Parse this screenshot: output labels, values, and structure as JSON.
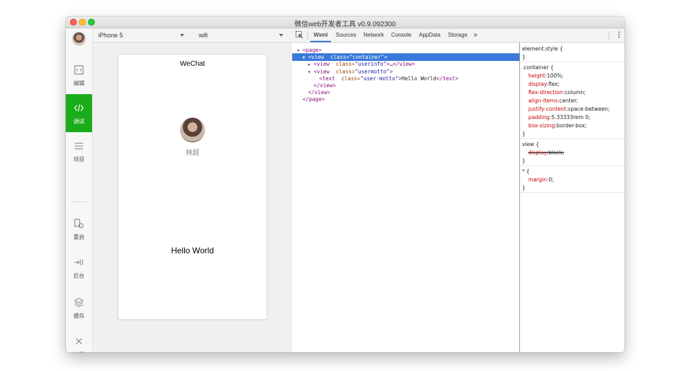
{
  "window": {
    "title": "微信web开发者工具 v0.9.092300"
  },
  "sidebar": {
    "items": [
      {
        "label": "编辑",
        "icon": "code-box-icon"
      },
      {
        "label": "调试",
        "icon": "code-icon",
        "active": true
      },
      {
        "label": "项目",
        "icon": "menu-icon"
      },
      {
        "label": "重启",
        "icon": "restart-icon"
      },
      {
        "label": "后台",
        "icon": "background-icon"
      },
      {
        "label": "缓存",
        "icon": "layers-icon"
      },
      {
        "label": "关闭",
        "icon": "close-icon"
      }
    ]
  },
  "toolbar": {
    "device": "iPhone 5",
    "network": "wifi",
    "tabs": [
      "Wxml",
      "Sources",
      "Network",
      "Console",
      "AppData",
      "Storage"
    ],
    "more": "»",
    "menu": "⋮"
  },
  "phone": {
    "title": "WeChat",
    "nickname": "林超",
    "motto": "Hello World"
  },
  "dom": {
    "lines": [
      {
        "indent": 0,
        "tri": "▼",
        "open": "<page>",
        "attrs": [],
        "text": "",
        "close": "",
        "selected": false
      },
      {
        "indent": 1,
        "tri": "▼",
        "open": "<view",
        "attrs": [
          {
            "name": "class",
            "value": "\"container\""
          }
        ],
        "end": ">",
        "text": "",
        "close": "",
        "selected": true
      },
      {
        "indent": 2,
        "tri": "▶",
        "open": "<view",
        "attrs": [
          {
            "name": "class",
            "value": "\"userinfo\""
          }
        ],
        "end": ">",
        "text": "…",
        "close": "</view>",
        "selected": false
      },
      {
        "indent": 2,
        "tri": "▼",
        "open": "<view",
        "attrs": [
          {
            "name": "class",
            "value": "\"usermotto\""
          }
        ],
        "end": ">",
        "text": "",
        "close": "",
        "selected": false
      },
      {
        "indent": 3,
        "tri": "",
        "open": "<text",
        "attrs": [
          {
            "name": "class",
            "value": "\"user-motto\""
          }
        ],
        "end": ">",
        "text": "Hello World",
        "close": "</text>",
        "selected": false
      },
      {
        "indent": 2,
        "tri": "",
        "open": "</view>",
        "attrs": [],
        "text": "",
        "close": "",
        "selected": false
      },
      {
        "indent": 1,
        "tri": "",
        "open": "</view>",
        "attrs": [],
        "text": "",
        "close": "",
        "selected": false
      },
      {
        "indent": 0,
        "tri": "",
        "open": "</page>",
        "attrs": [],
        "text": "",
        "close": "",
        "selected": false
      }
    ]
  },
  "styles": {
    "rules": [
      {
        "selector": "element.style {",
        "props": []
      },
      {
        "selector": ".container {",
        "props": [
          {
            "name": "height",
            "value": "100%;"
          },
          {
            "name": "display",
            "value": "flex;"
          },
          {
            "name": "flex-direction",
            "value": "column;"
          },
          {
            "name": "align-items",
            "value": "center;"
          },
          {
            "name": "justify-content",
            "value": "space-between;"
          },
          {
            "name": "padding",
            "value": "5.33333rem 0;"
          },
          {
            "name": "box-sizing",
            "value": "border-box;"
          }
        ]
      },
      {
        "selector": "view {",
        "props": [
          {
            "name": "display",
            "value": "block;",
            "struck": true
          }
        ]
      },
      {
        "selector": "* {",
        "props": [
          {
            "name": "margin",
            "value": "0;"
          }
        ]
      }
    ],
    "close": "}"
  },
  "colors": {
    "accent": "#1aad19",
    "selection": "#3879d9"
  }
}
